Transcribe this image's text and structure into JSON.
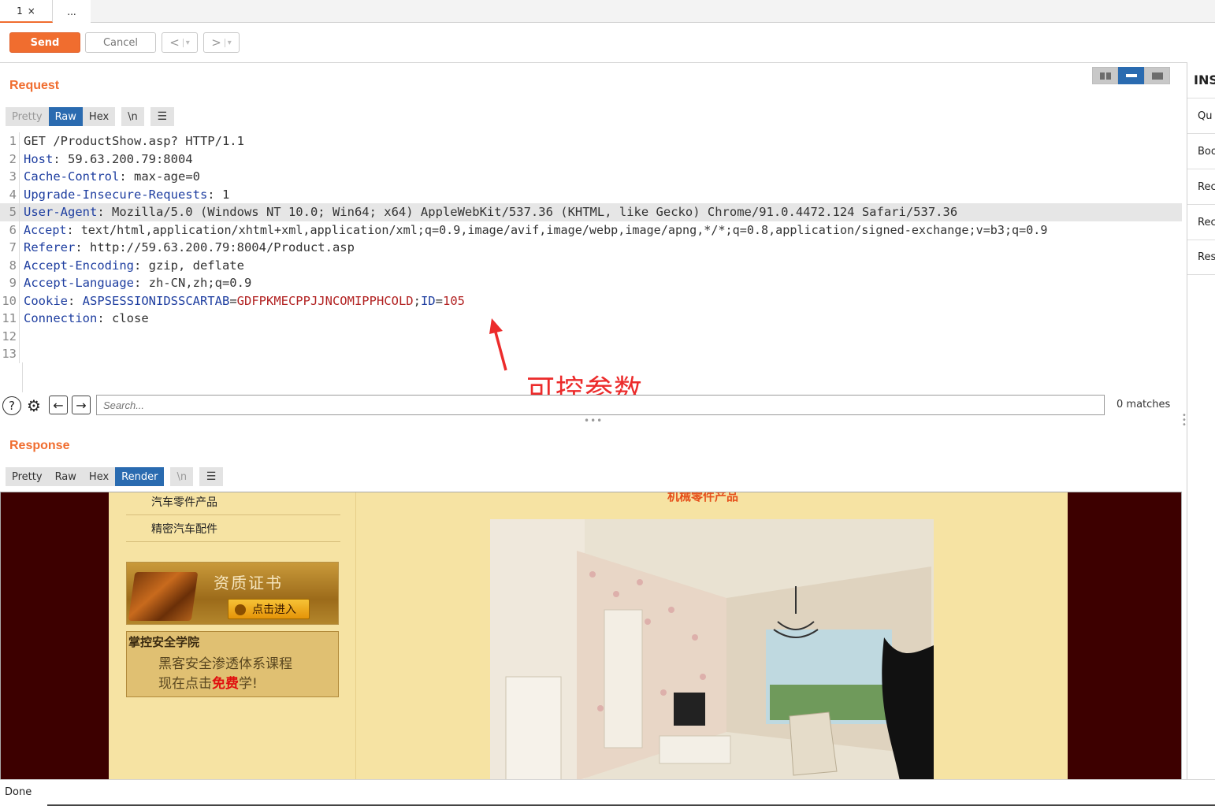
{
  "tabs": [
    {
      "label": "1",
      "close": "×"
    },
    {
      "label": "..."
    }
  ],
  "toolbar": {
    "send": "Send",
    "cancel": "Cancel",
    "back": "<",
    "forward": ">",
    "dropdown": "▾"
  },
  "request": {
    "title": "Request",
    "formats": [
      "Pretty",
      "Raw",
      "Hex",
      "\\n"
    ],
    "active_format": "Raw",
    "lines": [
      {
        "n": "1",
        "name": "",
        "text": "GET /ProductShow.asp? HTTP/1.1"
      },
      {
        "n": "2",
        "name": "Host",
        "text": ": 59.63.200.79:8004"
      },
      {
        "n": "3",
        "name": "Cache-Control",
        "text": ": max-age=0"
      },
      {
        "n": "4",
        "name": "Upgrade-Insecure-Requests",
        "text": ": 1"
      },
      {
        "n": "5",
        "name": "User-Agent",
        "text": ": Mozilla/5.0 (Windows NT 10.0; Win64; x64) AppleWebKit/537.36 (KHTML, like Gecko) Chrome/91.0.4472.124 Safari/537.36"
      },
      {
        "n": "6",
        "name": "Accept",
        "text": ": text/html,application/xhtml+xml,application/xml;q=0.9,image/avif,image/webp,image/apng,*/*;q=0.8,application/signed-exchange;v=b3;q=0.9"
      },
      {
        "n": "7",
        "name": "Referer",
        "text": ": http://59.63.200.79:8004/Product.asp"
      },
      {
        "n": "8",
        "name": "Accept-Encoding",
        "text": ": gzip, deflate"
      },
      {
        "n": "9",
        "name": "Accept-Language",
        "text": ": zh-CN,zh;q=0.9"
      },
      {
        "n": "10",
        "name": "Cookie",
        "text": ": "
      },
      {
        "n": "11",
        "name": "Connection",
        "text": ": close"
      },
      {
        "n": "12",
        "name": "",
        "text": ""
      },
      {
        "n": "13",
        "name": "",
        "text": ""
      }
    ],
    "cookie": {
      "name1": "ASPSESSIONIDSSCARTAB",
      "eq": "=",
      "val1": "GDFPKMECPPJJNCOMIPPHCOLD",
      "sep": ";",
      "name2": "ID",
      "eq2": "=",
      "val2": "105"
    },
    "highlighted_line": "5"
  },
  "annotation": {
    "text": "可控参数",
    "color": "#ec2b2b"
  },
  "search": {
    "placeholder": "Search...",
    "matches": "0 matches"
  },
  "response": {
    "title": "Response",
    "formats": [
      "Pretty",
      "Raw",
      "Hex",
      "Render",
      "\\n"
    ],
    "active_format": "Render",
    "render": {
      "links": [
        "汽车零件产品",
        "精密汽车配件"
      ],
      "cert_title": "资质证书",
      "cert_button": "点击进入",
      "promo_head": "掌控安全学院",
      "promo_line1": "黑客安全渗透体系课程",
      "promo_line2_a": "现在点击",
      "promo_free": "免费",
      "promo_line2_b": "学!",
      "section_title": "机械零件产品"
    }
  },
  "inspector": {
    "title": "INS",
    "items": [
      "Qu",
      "Boo",
      "Rec",
      "Rec",
      "Res"
    ]
  },
  "status": {
    "text": "Done"
  },
  "colors": {
    "accent": "#f06d2f",
    "active_tab": "#2a6bb0",
    "header_name": "#1e3ea0",
    "cookie_value": "#b22222"
  }
}
